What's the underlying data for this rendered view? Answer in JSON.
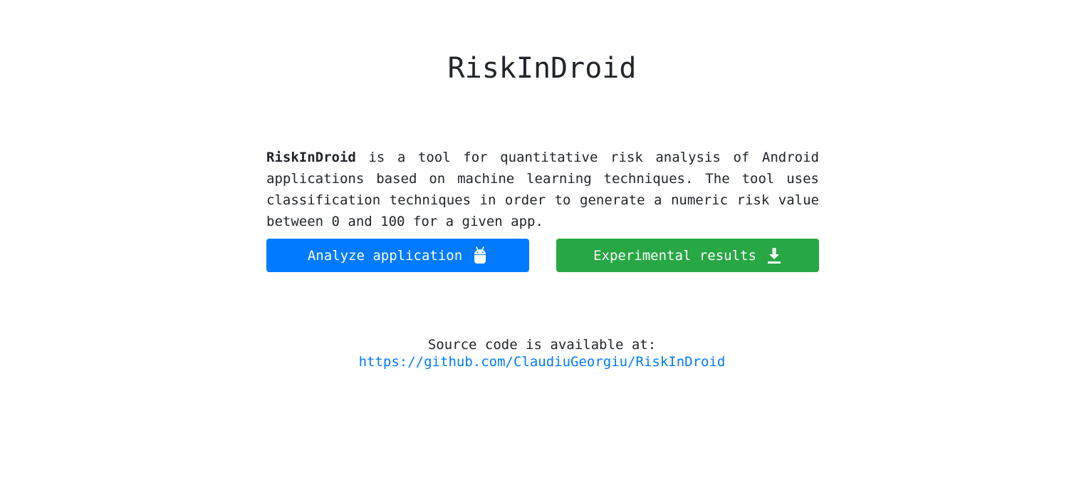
{
  "header": {
    "title": "RiskInDroid"
  },
  "intro": {
    "brand": "RiskInDroid",
    "text": " is a tool for quantitative risk analysis of Android applications based on machine learning techniques. The tool uses classification techniques in order to generate a numeric risk value between 0 and 100 for a given app."
  },
  "actions": {
    "analyze_label": "Analyze application",
    "analyze_icon": "android-icon",
    "results_label": "Experimental results",
    "results_icon": "download-icon"
  },
  "footer": {
    "source_label": "Source code is available at:",
    "source_link": "https://github.com/ClaudiuGeorgiu/RiskInDroid"
  },
  "colors": {
    "primary": "#007bff",
    "success": "#28a745",
    "text": "#212529"
  }
}
